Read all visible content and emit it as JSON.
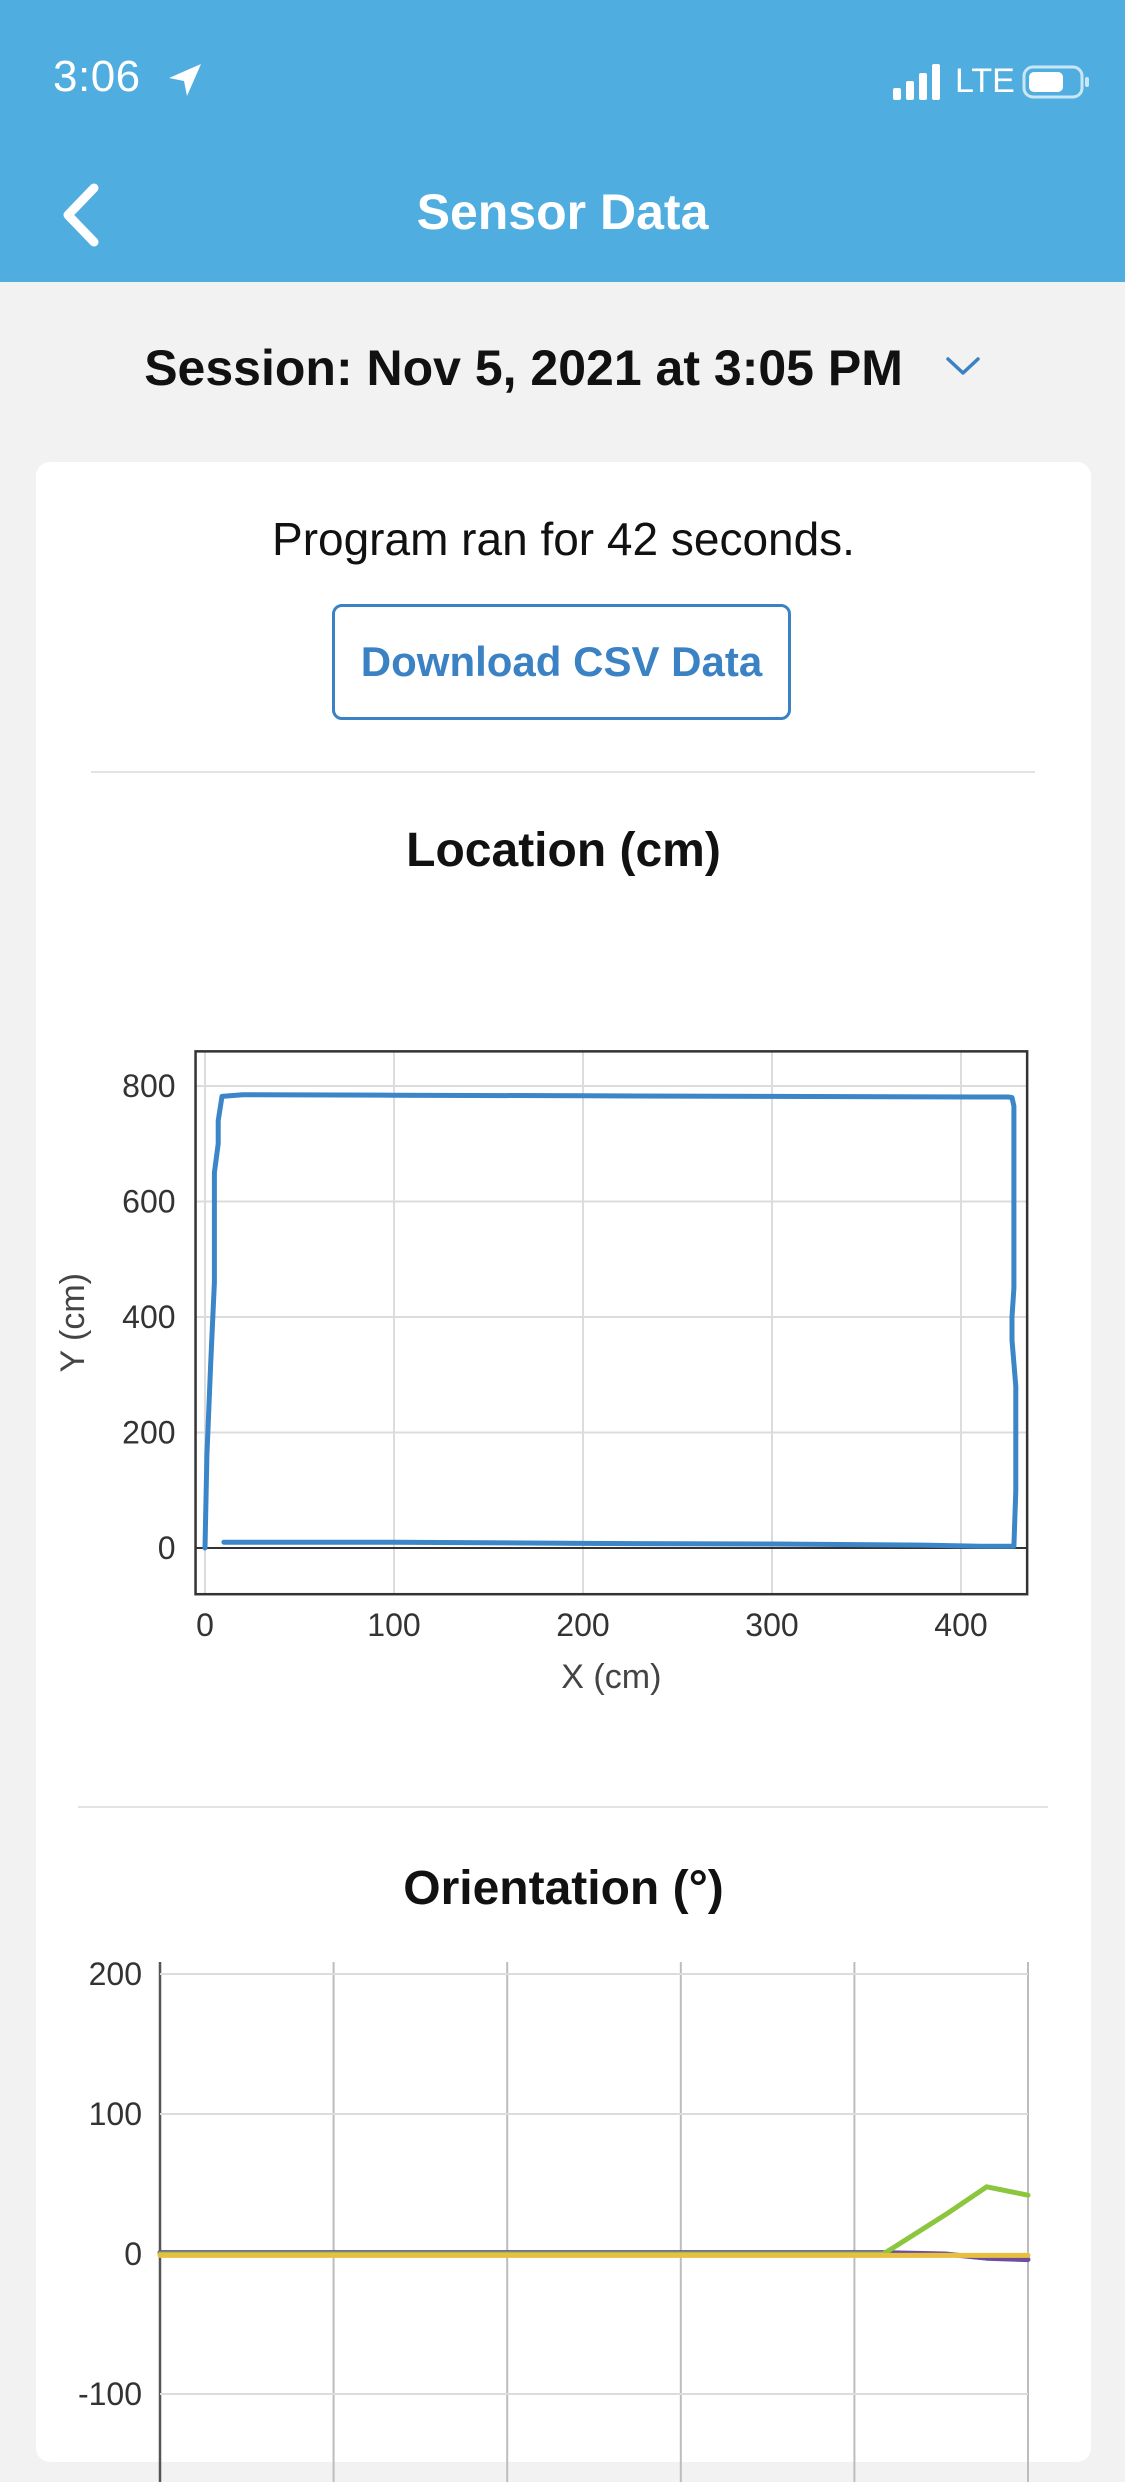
{
  "status_bar": {
    "time": "3:06",
    "network": "LTE"
  },
  "header": {
    "title": "Sensor Data",
    "color": "#4fade0"
  },
  "session": {
    "label": "Session: Nov 5, 2021 at 3:05 PM"
  },
  "card": {
    "run_text": "Program ran for 42 seconds.",
    "download_label": "Download CSV Data"
  },
  "location_chart": {
    "title": "Location (cm)"
  },
  "orientation_chart": {
    "title": "Orientation (°)"
  },
  "chart_data": [
    {
      "type": "line",
      "title": "Location (cm)",
      "xlabel": "X (cm)",
      "ylabel": "Y (cm)",
      "xlim": [
        -5,
        435
      ],
      "ylim": [
        -80,
        860
      ],
      "xticks": [
        0,
        100,
        200,
        300,
        400
      ],
      "yticks": [
        0,
        200,
        400,
        600,
        800
      ],
      "grid": true,
      "series": [
        {
          "color": "#3a86c8",
          "x": [
            10,
            100,
            200,
            300,
            380,
            410,
            428,
            429,
            429,
            427,
            427,
            428,
            428,
            428,
            428,
            427,
            425,
            410,
            300,
            200,
            100,
            20,
            9,
            7,
            7,
            5,
            5,
            3,
            2,
            1,
            0
          ],
          "y": [
            10,
            10,
            8,
            7,
            5,
            3,
            3,
            100,
            280,
            360,
            400,
            450,
            600,
            740,
            765,
            780,
            781,
            781,
            782,
            783,
            784,
            785,
            782,
            740,
            700,
            650,
            460,
            320,
            240,
            160,
            0
          ]
        }
      ]
    },
    {
      "type": "line",
      "title": "Orientation (°)",
      "xlabel": "",
      "ylabel": "",
      "ylim": [
        -100,
        200
      ],
      "yticks": [
        -100,
        0,
        100,
        200
      ],
      "grid": true,
      "x": [
        0,
        5,
        10,
        15,
        20,
        25,
        30,
        35,
        38,
        40,
        42
      ],
      "series": [
        {
          "color": "#6b4f9e",
          "values": [
            1,
            1,
            1,
            1,
            1,
            1,
            1,
            1,
            0,
            -3,
            -4
          ]
        },
        {
          "color": "#8cc63f",
          "values": [
            0,
            0,
            0,
            0,
            0,
            0,
            0,
            0,
            28,
            48,
            42
          ]
        },
        {
          "color": "#e8c040",
          "values": [
            -1,
            -1,
            -1,
            -1,
            -1,
            -1,
            -1,
            -1,
            -1,
            -1,
            -1
          ]
        }
      ]
    }
  ]
}
